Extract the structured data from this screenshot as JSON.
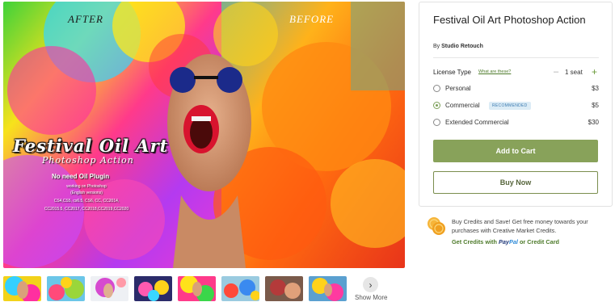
{
  "hero": {
    "label_after": "AFTER",
    "label_before": "BEFORE",
    "promo_title": "Festival Oil Art",
    "promo_subtitle": "Photoshop  Action",
    "promo_note": "No need Oil Plugin",
    "promo_lines": [
      "working on Photoshop",
      "(English versions)",
      "CS4,CS5, cs6.5, CS6, CC, CC2014,",
      "CC2015.5, CC2017, CC2018,CC2019,CC2020"
    ]
  },
  "thumbnails": {
    "count": 8,
    "show_more_label": "Show More"
  },
  "product": {
    "title": "Festival Oil Art Photoshop Action",
    "author_prefix": "By",
    "author": "Studio Retouch",
    "license_label": "License Type",
    "license_help": "What are these?",
    "seat_value": "1 seat",
    "options": [
      {
        "label": "Personal",
        "price": "$3",
        "checked": false
      },
      {
        "label": "Commercial",
        "price": "$5",
        "checked": true,
        "badge": "RECOMMENDED"
      },
      {
        "label": "Extended Commercial",
        "price": "$30",
        "checked": false
      }
    ],
    "add_to_cart": "Add to Cart",
    "buy_now": "Buy Now"
  },
  "credits": {
    "text": "Buy Credits and Save! Get free money towards your purchases with Creative Market Credits.",
    "link_prefix": "Get Credits with",
    "paypal_a": "Pay",
    "paypal_b": "Pal",
    "link_suffix": "or Credit Card"
  },
  "colors": {
    "accent_green": "#88a25a",
    "link_green": "#4d7a2a",
    "badge_blue": "#3b7ab0"
  }
}
